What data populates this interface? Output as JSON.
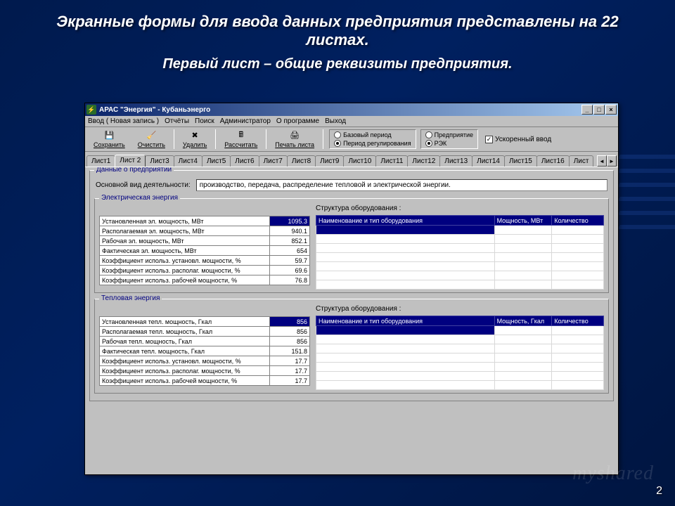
{
  "slide": {
    "title": "Экранные формы для ввода данных предприятия представлены на 22 листах.",
    "subtitle": "Первый лист – общие реквизиты предприятия.",
    "page_number": "2",
    "watermark": "myshared"
  },
  "window": {
    "title": "АРАС \"Энергия\" - Кубаньэнерго"
  },
  "menubar": {
    "items": [
      "Ввод ( Новая запись )",
      "Отчёты",
      "Поиск",
      "Администратор",
      "О программе",
      "Выход"
    ]
  },
  "toolbar": {
    "save": "Сохранить",
    "clear": "Очистить",
    "delete": "Удалить",
    "calc": "Рассчитать",
    "print": "Печать листа",
    "period_base": "Базовый период",
    "period_reg": "Период регулирования",
    "org_pred": "Предприятие",
    "org_rek": "РЭК",
    "fast_input": "Ускоренный ввод"
  },
  "tabs": [
    "Лист1",
    "Лист 2",
    "Лист3",
    "Лист4",
    "Лист5",
    "Лист6",
    "Лист7",
    "Лист8",
    "Лист9",
    "Лист10",
    "Лист11",
    "Лист12",
    "Лист13",
    "Лист14",
    "Лист15",
    "Лист16",
    "Лист"
  ],
  "sheet": {
    "group_title": "Данные о предприятии",
    "activity_label": "Основной вид деятельности:",
    "activity_value": "производство, передача, распределение тепловой и электрической энергии.",
    "electric_title": "Электрическая энергия",
    "thermal_title": "Тепловая энергия",
    "struct_label": "Структура оборудования :",
    "equip_headers_e": [
      "Наименование и тип оборудования",
      "Мощность, МВт",
      "Количество"
    ],
    "equip_headers_t": [
      "Наименование и тип оборудования",
      "Мощность, Гкал",
      "Количество"
    ],
    "electric_params": [
      {
        "label": "Установленная эл. мощность, МВт",
        "value": "1095.3",
        "hl": true
      },
      {
        "label": "Располагаемая эл. мощность, МВт",
        "value": "940.1"
      },
      {
        "label": "Рабочая эл. мощность, МВт",
        "value": "852.1"
      },
      {
        "label": "Фактическая эл. мощность, МВт",
        "value": "654"
      },
      {
        "label": "Коэффициент использ. установл. мощности, %",
        "value": "59.7"
      },
      {
        "label": "Коэффициент использ. располаг. мощности, %",
        "value": "69.6"
      },
      {
        "label": "Коэффициент использ. рабочей мощности, %",
        "value": "76.8"
      }
    ],
    "thermal_params": [
      {
        "label": "Установленная тепл. мощность, Гкал",
        "value": "856",
        "hl": true
      },
      {
        "label": "Располагаемая тепл. мощность, Гкал",
        "value": "856"
      },
      {
        "label": "Рабочая тепл. мощность, Гкал",
        "value": "856"
      },
      {
        "label": "Фактическая тепл. мощность, Гкал",
        "value": "151.8"
      },
      {
        "label": "Коэффициент использ. установл. мощности, %",
        "value": "17.7"
      },
      {
        "label": "Коэффициент использ. располаг. мощности, %",
        "value": "17.7"
      },
      {
        "label": "Коэффициент использ. рабочей мощности, %",
        "value": "17.7"
      }
    ]
  }
}
